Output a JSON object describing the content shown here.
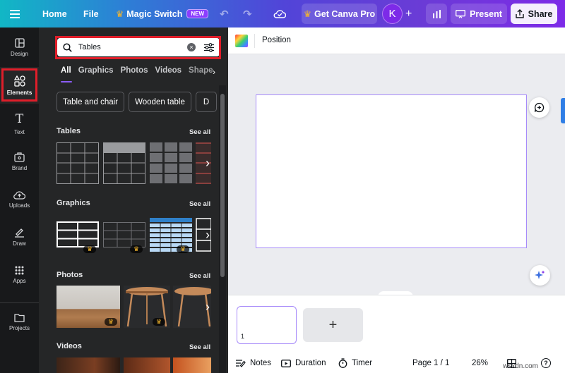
{
  "topbar": {
    "home": "Home",
    "file": "File",
    "magic_switch": "Magic Switch",
    "new_badge": "NEW",
    "get_pro": "Get Canva Pro",
    "avatar_letter": "K",
    "present": "Present",
    "share": "Share"
  },
  "rail": {
    "design": "Design",
    "elements": "Elements",
    "text": "Text",
    "brand": "Brand",
    "uploads": "Uploads",
    "draw": "Draw",
    "apps": "Apps",
    "projects": "Projects"
  },
  "panel": {
    "search_value": "Tables",
    "tabs": [
      "All",
      "Graphics",
      "Photos",
      "Videos",
      "Shape"
    ],
    "chips": [
      "Table and chair",
      "Wooden table",
      "D"
    ],
    "sections": {
      "tables": "Tables",
      "graphics": "Graphics",
      "photos": "Photos",
      "videos": "Videos"
    },
    "see_all": "See all"
  },
  "canvas": {
    "position_label": "Position"
  },
  "pages": {
    "page_number": "1"
  },
  "footer": {
    "notes": "Notes",
    "duration": "Duration",
    "timer": "Timer",
    "page_indicator": "Page 1 / 1",
    "zoom": "26%"
  },
  "watermark": "wsxdn.com",
  "colors": {
    "accent": "#8b3dff",
    "highlight_box": "#e01e2a",
    "page_border": "#a78bfa"
  }
}
